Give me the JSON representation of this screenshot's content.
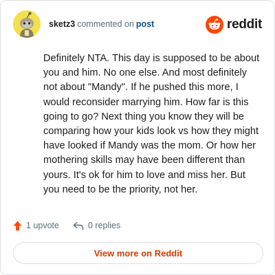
{
  "comment": {
    "username": "sketz3",
    "action_text": "commented on",
    "post_link_label": "post",
    "body": "Definitely NTA. This day is supposed to be about you and him. No one else. And most definitely not about \"Mandy\". If he pushed this more, I would reconsider marrying him. How far is this going to go? Next thing you know they will be comparing how your kids look vs how they might have looked if Mandy was the mom. Or how her mothering skills may have been different than yours. It's ok for him to love and miss her. But you need to be the priority, not her."
  },
  "brand": {
    "name": "reddit",
    "icon": "reddit-logo-icon",
    "color": "#ff4500"
  },
  "stats": {
    "upvote_label": "1 upvote",
    "upvote_icon": "upvote-arrow-icon",
    "replies_label": "0 replies",
    "replies_icon": "reply-arrow-icon"
  },
  "footer": {
    "view_more_label": "View more on Reddit"
  },
  "colors": {
    "accent": "#d93a00",
    "upvote": "#ff4500",
    "link": "#0b4f86",
    "muted": "#576f76",
    "border": "#dcdfe3",
    "avatar_bg": "#f4e04d"
  }
}
